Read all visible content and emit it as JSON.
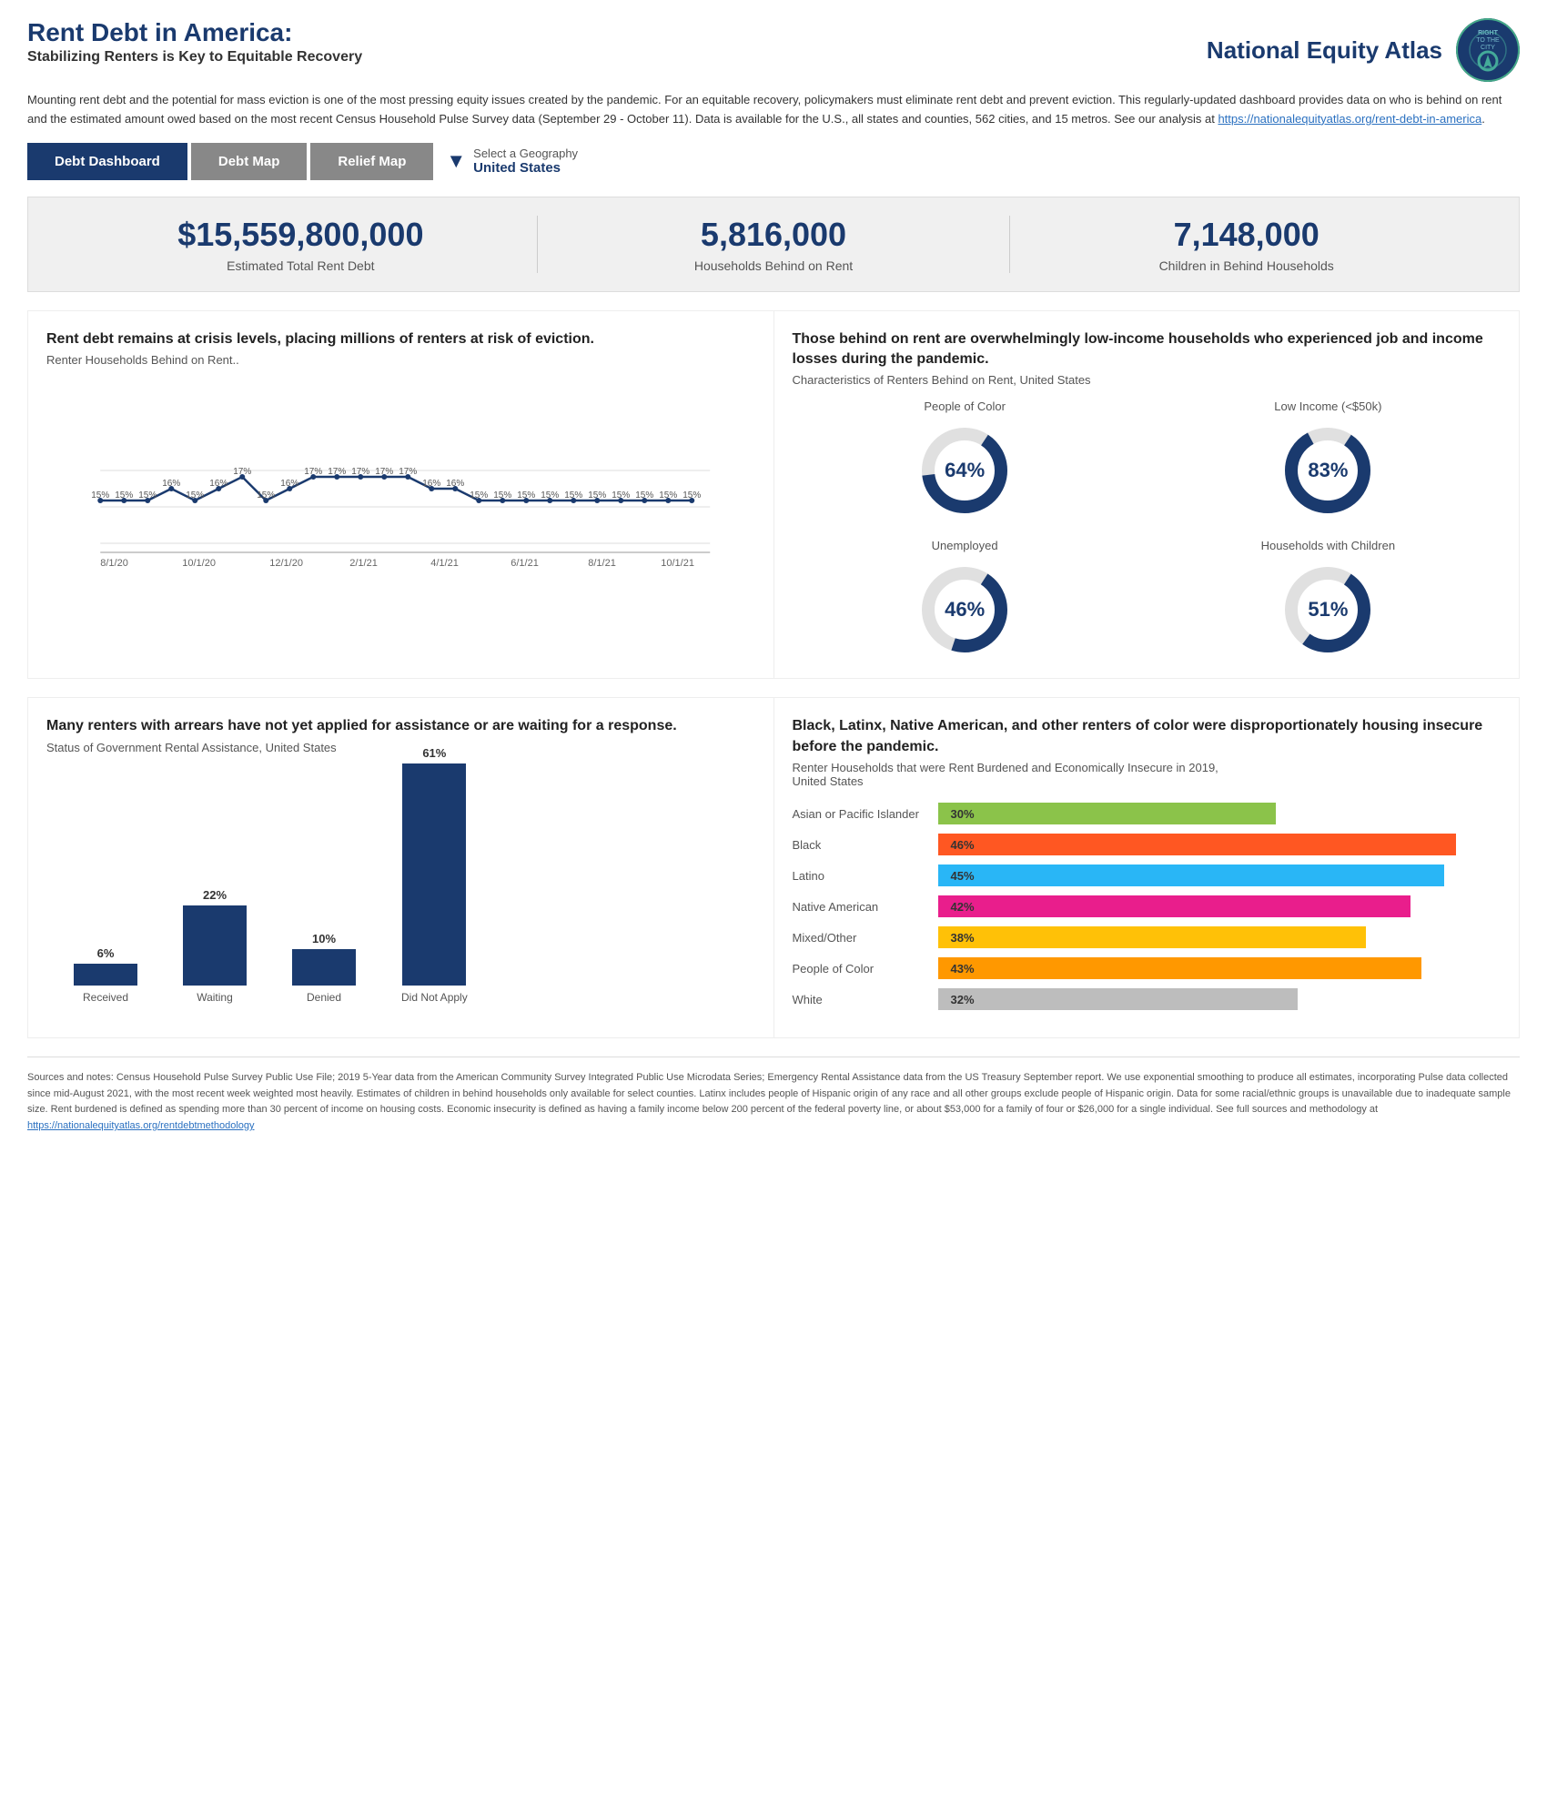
{
  "header": {
    "title": "Rent Debt in America:",
    "subtitle": "Stabilizing Renters is Key to Equitable Recovery",
    "logo_text": "National Equity Atlas",
    "logo_circle_lines": [
      "RIGHT",
      "TO",
      "THE",
      "CITY"
    ]
  },
  "description": {
    "text1": "Mounting rent debt and the potential for mass eviction is one of the most pressing equity issues created by the pandemic. For an equitable recovery, policymakers must eliminate rent debt and prevent eviction. This regularly-updated dashboard provides data on who is behind on rent and the estimated amount owed based on the most recent Census Household Pulse Survey data (September 29 - October 11). Data is available for the U.S., all states and counties, 562 cities, and 15 metros. See our analysis at ",
    "link_text": "https://nationalequityatlas.org/rent-debt-in-america",
    "link_url": "https://nationalequityatlas.org/rent-debt-in-america",
    "text2": "."
  },
  "nav": {
    "tabs": [
      {
        "label": "Debt Dashboard",
        "active": true
      },
      {
        "label": "Debt Map",
        "active": false
      },
      {
        "label": "Relief Map",
        "active": false
      }
    ],
    "geo_label": "Select a Geography",
    "geo_value": "United States"
  },
  "stats": [
    {
      "value": "$15,559,800,000",
      "label": "Estimated Total Rent Debt"
    },
    {
      "value": "5,816,000",
      "label": "Households Behind on Rent"
    },
    {
      "value": "7,148,000",
      "label": "Children in Behind Households"
    }
  ],
  "line_chart": {
    "title": "Rent debt remains at crisis levels, placing millions of renters at risk of eviction.",
    "subtitle": "Renter Households Behind on Rent..",
    "x_labels": [
      "8/1/20",
      "10/1/20",
      "12/1/20",
      "2/1/21",
      "4/1/21",
      "6/1/21",
      "8/1/21",
      "10/1/21"
    ],
    "data_points": [
      {
        "x": 0,
        "y": 15,
        "label": "15%"
      },
      {
        "x": 1,
        "y": 15,
        "label": "15%"
      },
      {
        "x": 2,
        "y": 15,
        "label": "15%"
      },
      {
        "x": 3,
        "y": 16,
        "label": "16%"
      },
      {
        "x": 4,
        "y": 15,
        "label": "15%"
      },
      {
        "x": 5,
        "y": 16,
        "label": "16%"
      },
      {
        "x": 6,
        "y": 17,
        "label": "17%"
      },
      {
        "x": 7,
        "y": 15,
        "label": "15%"
      },
      {
        "x": 8,
        "y": 16,
        "label": "16%"
      },
      {
        "x": 9,
        "y": 17,
        "label": "17%"
      },
      {
        "x": 10,
        "y": 17,
        "label": "17%"
      },
      {
        "x": 11,
        "y": 17,
        "label": "17%"
      },
      {
        "x": 12,
        "y": 17,
        "label": "17%"
      },
      {
        "x": 13,
        "y": 17,
        "label": "17%"
      },
      {
        "x": 14,
        "y": 16,
        "label": "16%"
      },
      {
        "x": 15,
        "y": 16,
        "label": "16%"
      },
      {
        "x": 16,
        "y": 15,
        "label": "15%"
      },
      {
        "x": 17,
        "y": 15,
        "label": "15%"
      },
      {
        "x": 18,
        "y": 15,
        "label": "15%"
      },
      {
        "x": 19,
        "y": 15,
        "label": "15%"
      },
      {
        "x": 20,
        "y": 15,
        "label": "15%"
      },
      {
        "x": 21,
        "y": 15,
        "label": "15%"
      },
      {
        "x": 22,
        "y": 15,
        "label": "15%"
      },
      {
        "x": 23,
        "y": 15,
        "label": "15%"
      },
      {
        "x": 24,
        "y": 15,
        "label": "15%"
      },
      {
        "x": 25,
        "y": 15,
        "label": "15%"
      }
    ]
  },
  "donut_charts": {
    "title": "Those behind on rent are overwhelmingly low-income households who experienced job and income losses during the pandemic.",
    "subtitle": "Characteristics of Renters Behind on Rent,  United States",
    "items": [
      {
        "label": "People of Color",
        "value": 64,
        "display": "64%"
      },
      {
        "label": "Low Income (<$50k)",
        "value": 83,
        "display": "83%"
      },
      {
        "label": "Unemployed",
        "value": 46,
        "display": "46%"
      },
      {
        "label": "Households with Children",
        "value": 51,
        "display": "51%"
      }
    ]
  },
  "bar_chart": {
    "title": "Many renters with arrears have not yet applied for assistance or are waiting for a response.",
    "subtitle": "Status of Government Rental Assistance, United States",
    "bars": [
      {
        "label": "Received",
        "pct": 6,
        "display": "6%"
      },
      {
        "label": "Waiting",
        "pct": 22,
        "display": "22%"
      },
      {
        "label": "Denied",
        "pct": 10,
        "display": "10%"
      },
      {
        "label": "Did Not Apply",
        "pct": 61,
        "display": "61%"
      }
    ]
  },
  "hbar_chart": {
    "title": "Black, Latinx, Native American, and other renters of color were disproportionately housing insecure before the pandemic.",
    "subtitle": "Renter Households  that were Rent Burdened and Economically Insecure in 2019,\nUnited States",
    "bars": [
      {
        "label": "Asian or Pacific Islander",
        "pct": 30,
        "display": "30%",
        "color": "#8BC34A"
      },
      {
        "label": "Black",
        "pct": 46,
        "display": "46%",
        "color": "#FF5722"
      },
      {
        "label": "Latino",
        "pct": 45,
        "display": "45%",
        "color": "#29B6F6"
      },
      {
        "label": "Native American",
        "pct": 42,
        "display": "42%",
        "color": "#E91E8C"
      },
      {
        "label": "Mixed/Other",
        "pct": 38,
        "display": "38%",
        "color": "#FFC107"
      },
      {
        "label": "People of Color",
        "pct": 43,
        "display": "43%",
        "color": "#FF9800"
      },
      {
        "label": "White",
        "pct": 32,
        "display": "32%",
        "color": "#BDBDBD"
      }
    ],
    "max_pct": 50
  },
  "footer": {
    "text": "Sources and notes: Census Household Pulse Survey Public Use File; 2019 5-Year data from the American Community Survey Integrated Public Use Microdata Series; Emergency Rental Assistance data from the US Treasury September report. We use exponential smoothing to produce all estimates, incorporating Pulse data collected since mid-August 2021, with the most recent week weighted most heavily. Estimates of children in behind households only available for select counties. Latinx includes people of Hispanic origin of any race and all other groups exclude people of Hispanic origin. Data for some racial/ethnic groups is unavailable due to inadequate sample size. Rent burdened is defined as spending more than 30 percent of income on housing costs. Economic insecurity is defined as having a family income below 200 percent of the federal poverty line, or about $53,000 for a family of four or $26,000 for a single individual. See full sources and methodology at ",
    "link_text": "https://nationalequityatlas.org/rentdebtmethodology",
    "link_url": "https://nationalequityatlas.org/rentdebtmethodology"
  }
}
